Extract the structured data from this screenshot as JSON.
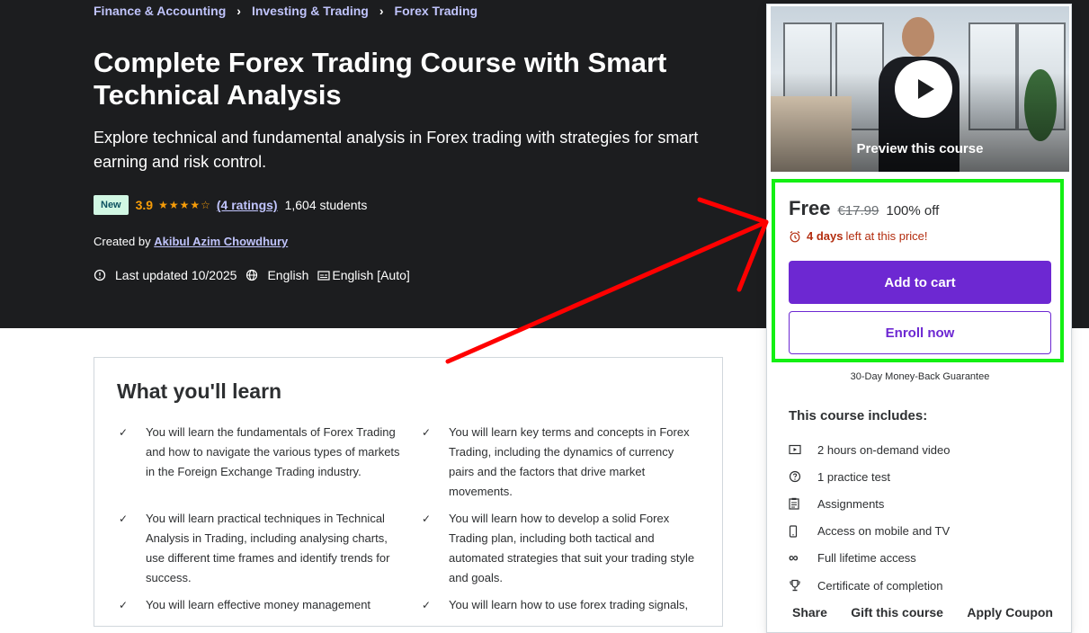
{
  "breadcrumb": [
    {
      "label": "Finance & Accounting"
    },
    {
      "label": "Investing & Trading"
    },
    {
      "label": "Forex Trading"
    }
  ],
  "course": {
    "title": "Complete Forex Trading Course with Smart Technical Analysis",
    "subtitle": "Explore technical and fundamental analysis in Forex trading with strategies for smart earning and risk control.",
    "badge": "New",
    "rating": "3.9",
    "rating_value": 3.9,
    "ratings_count": "(4 ratings)",
    "students": "1,604 students",
    "created_by_label": "Created by",
    "instructor": "Akibul Azim Chowdhury",
    "last_updated": "Last updated 10/2025",
    "language": "English",
    "captions": "English [Auto]"
  },
  "learn": {
    "title": "What you'll learn",
    "items": [
      "You will learn the fundamentals of Forex Trading and how to navigate the various types of markets in the Foreign Exchange Trading industry.",
      "You will learn key terms and concepts in Forex Trading, including the dynamics of currency pairs and the factors that drive market movements.",
      "You will learn practical techniques in Technical Analysis in Trading, including analysing charts, use different time frames and identify trends for success.",
      "You will learn how to develop a solid Forex Trading plan, including both tactical and automated strategies that suit your trading style and goals.",
      "You will learn effective money management",
      "You will learn how to use forex trading signals,"
    ]
  },
  "sidebar": {
    "preview_label": "Preview this course",
    "price": "Free",
    "original_price": "€17.99",
    "discount": "100% off",
    "timer_days": "4 days",
    "timer_suffix": "left at this price!",
    "add_to_cart": "Add to cart",
    "enroll_now": "Enroll now",
    "guarantee": "30-Day Money-Back Guarantee",
    "includes_title": "This course includes:",
    "includes": [
      {
        "icon": "video-icon",
        "label": "2 hours on-demand video"
      },
      {
        "icon": "question-circle-icon",
        "label": "1 practice test"
      },
      {
        "icon": "clipboard-icon",
        "label": "Assignments"
      },
      {
        "icon": "mobile-icon",
        "label": "Access on mobile and TV"
      },
      {
        "icon": "infinity-icon",
        "label": "Full lifetime access"
      },
      {
        "icon": "trophy-icon",
        "label": "Certificate of completion"
      }
    ],
    "share": "Share",
    "gift": "Gift this course",
    "coupon": "Apply Coupon"
  },
  "colors": {
    "hero_bg": "#1c1d1f",
    "accent_purple": "#6d28d2",
    "link_lavender": "#c0c4fc",
    "star_orange": "#f69c08",
    "timer_red": "#b32d0f",
    "highlight_green": "#13f013",
    "arrow_red": "#ff0000"
  }
}
